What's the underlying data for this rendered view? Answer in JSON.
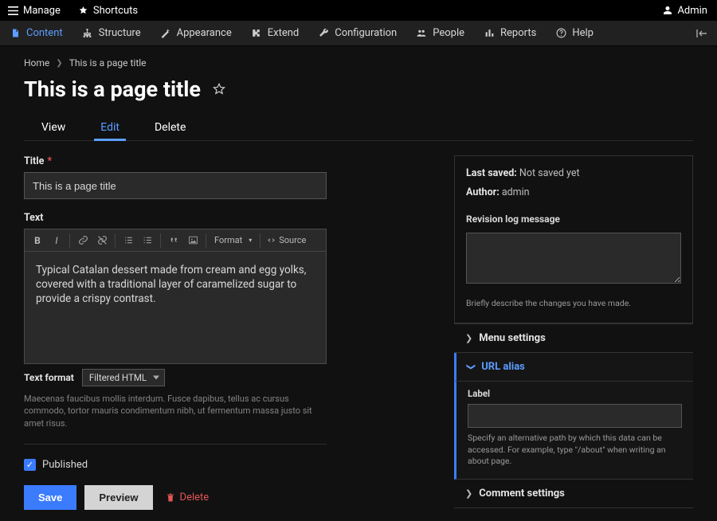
{
  "topbar": {
    "manage": "Manage",
    "shortcuts": "Shortcuts",
    "user": "Admin"
  },
  "admin_menu": {
    "items": [
      {
        "label": "Content",
        "icon": "file"
      },
      {
        "label": "Structure",
        "icon": "sitemap"
      },
      {
        "label": "Appearance",
        "icon": "wand"
      },
      {
        "label": "Extend",
        "icon": "puzzle"
      },
      {
        "label": "Configuration",
        "icon": "wrench"
      },
      {
        "label": "People",
        "icon": "people"
      },
      {
        "label": "Reports",
        "icon": "bars"
      },
      {
        "label": "Help",
        "icon": "help"
      }
    ]
  },
  "breadcrumb": {
    "home": "Home",
    "current": "This is a page title"
  },
  "page_title": "This is a page title",
  "tabs": {
    "view": "View",
    "edit": "Edit",
    "delete": "Delete"
  },
  "form": {
    "title_label": "Title",
    "title_value": "This is a page title",
    "text_label": "Text",
    "body_text": "Typical Catalan dessert made from cream and egg yolks, covered with a traditional layer of caramelized sugar to provide a crispy contrast.",
    "format_dropdown": "Format",
    "source_btn": "Source",
    "text_format_label": "Text format",
    "text_format_value": "Filtered HTML",
    "format_help": "Maecenas faucibus mollis interdum. Fusce dapibus, tellus ac cursus commodo, tortor mauris condimentum nibh, ut fermentum massa justo sit amet risus.",
    "published_label": "Published",
    "save": "Save",
    "preview": "Preview",
    "delete": "Delete"
  },
  "sidebar": {
    "last_saved_label": "Last saved:",
    "last_saved_value": "Not saved yet",
    "author_label": "Author:",
    "author_value": "admin",
    "revision_label": "Revision log message",
    "revision_help": "Briefly describe the changes you have made.",
    "menu_settings": "Menu settings",
    "url_alias": "URL alias",
    "url_label": "Label",
    "url_help": "Specify an alternative path by which this data can be accessed. For example, type \"/about\" when writing an about page.",
    "comment_settings": "Comment settings"
  }
}
